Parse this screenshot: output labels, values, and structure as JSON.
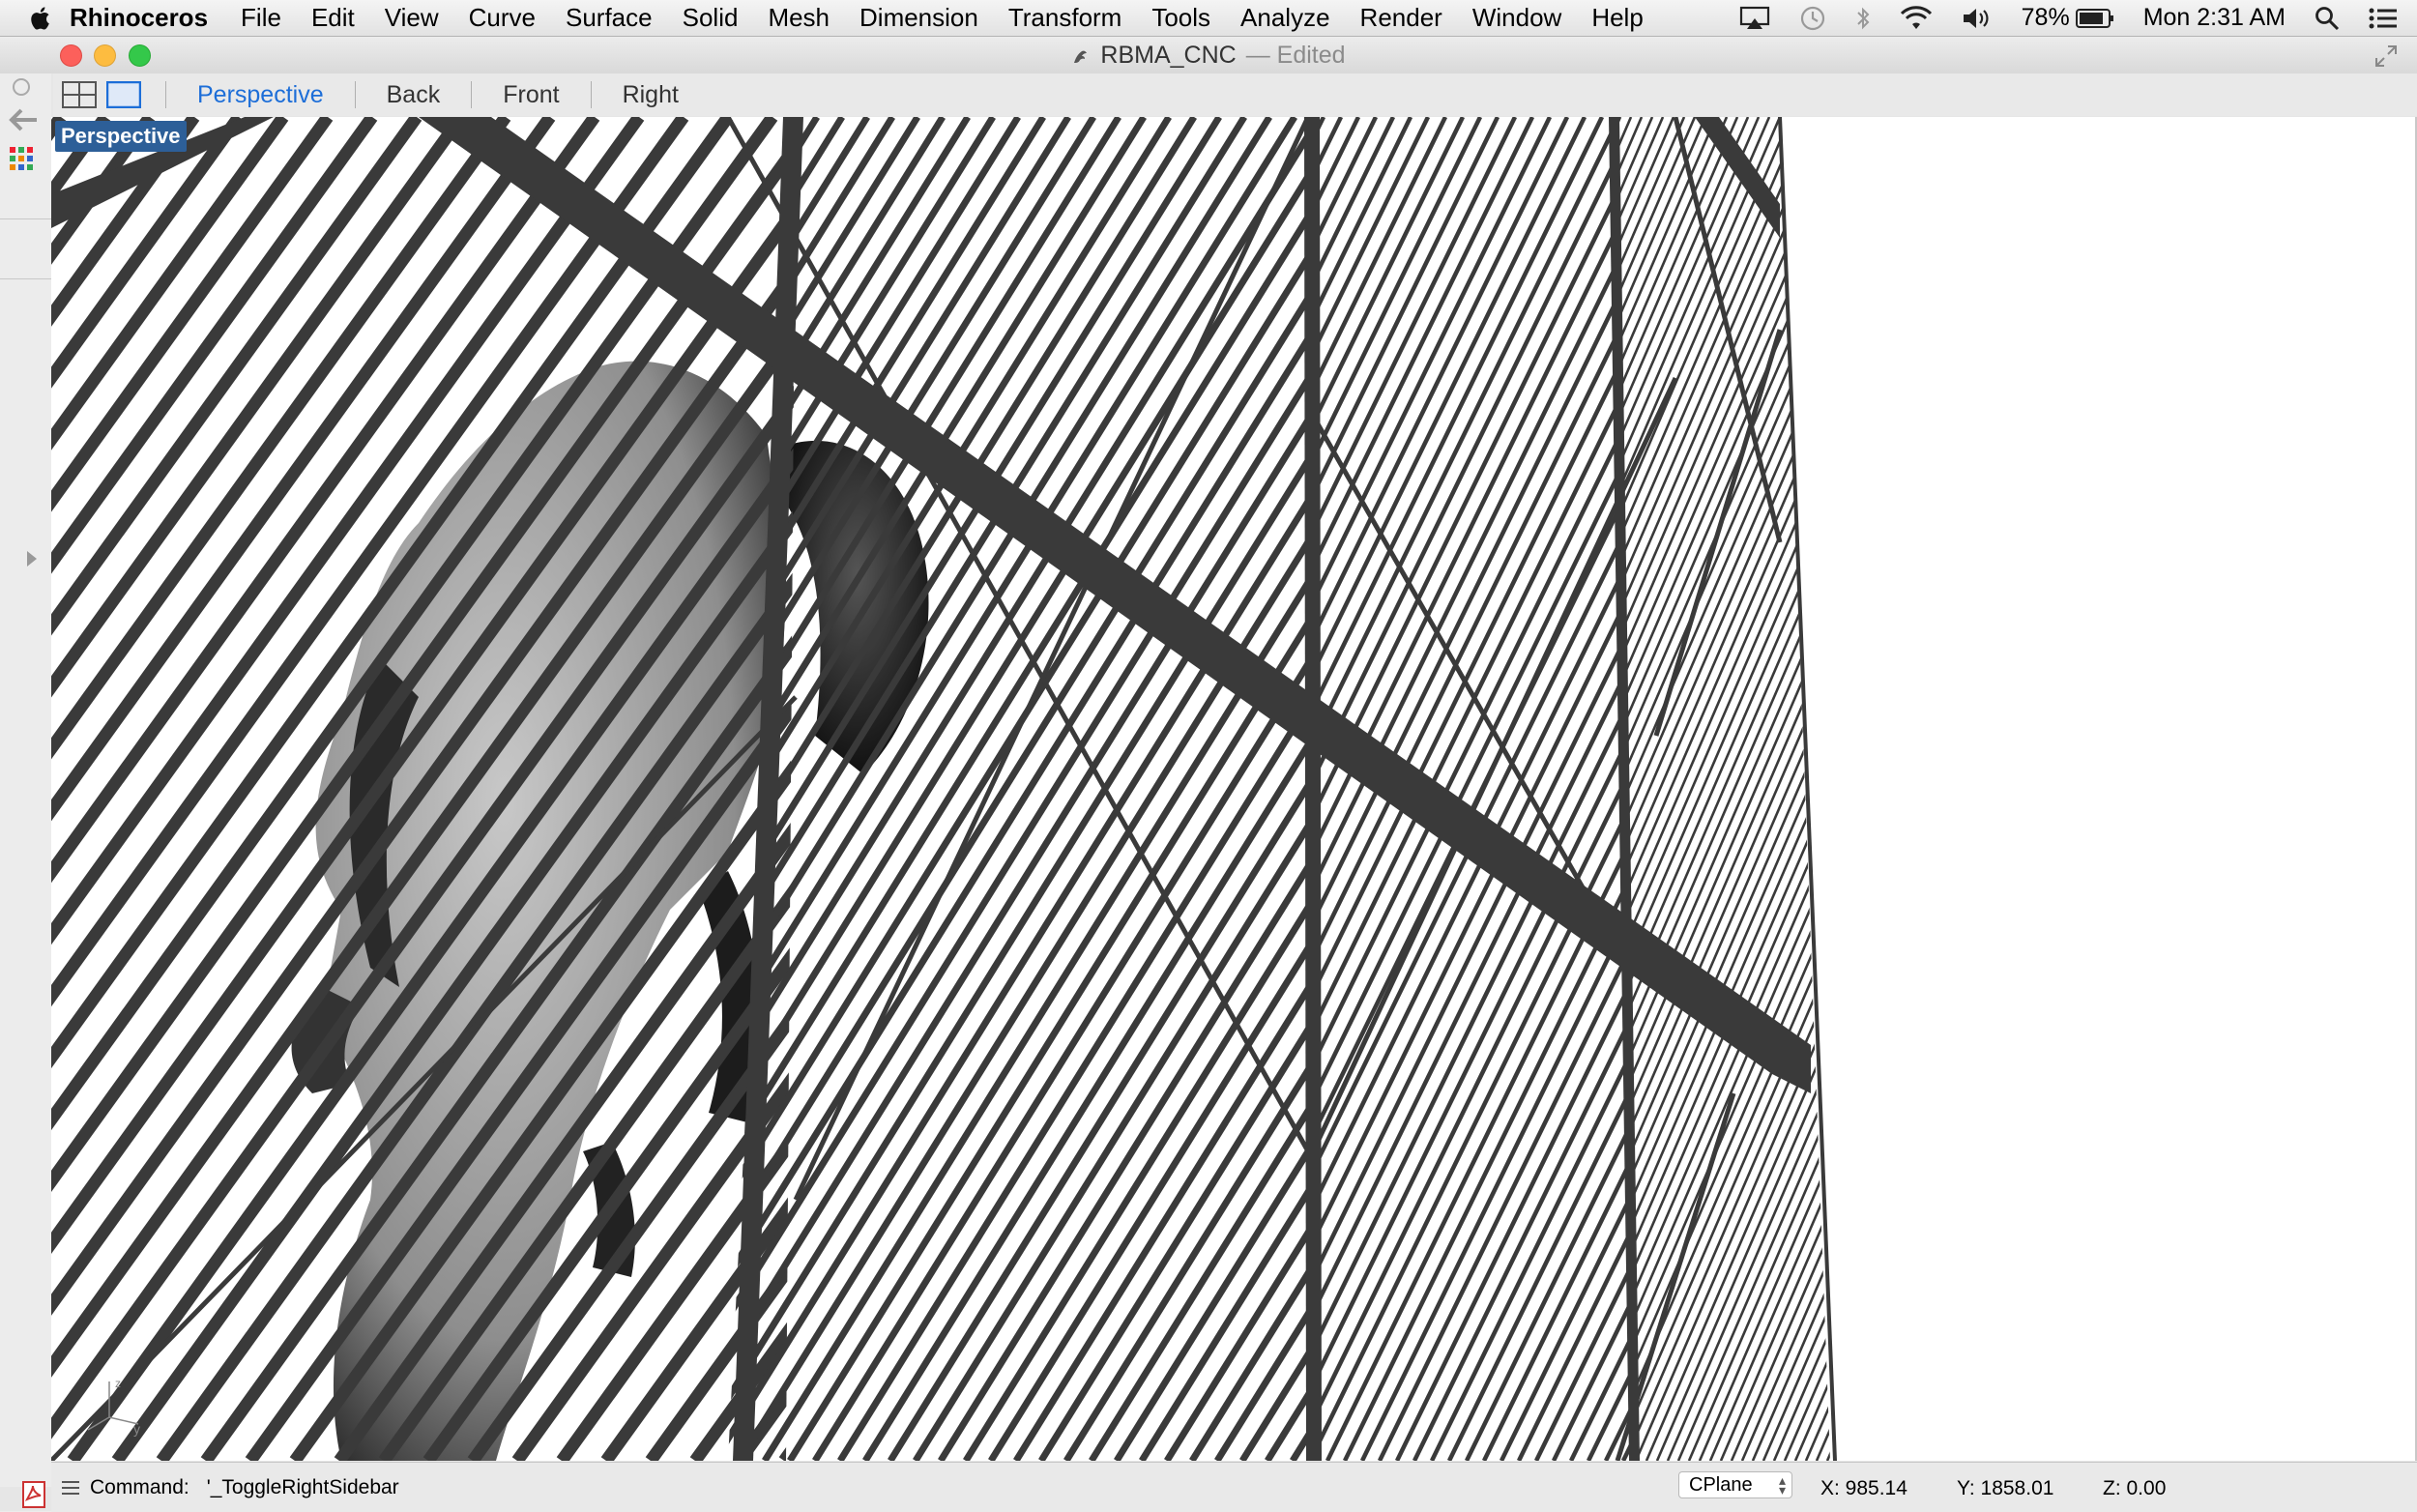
{
  "menubar": {
    "app_name": "Rhinoceros",
    "items": [
      "File",
      "Edit",
      "View",
      "Curve",
      "Surface",
      "Solid",
      "Mesh",
      "Dimension",
      "Transform",
      "Tools",
      "Analyze",
      "Render",
      "Window",
      "Help"
    ],
    "status": {
      "battery": "78%",
      "clock": "Mon 2:31 AM"
    },
    "icons": [
      "apple-icon",
      "airplay-icon",
      "time-machine-icon",
      "bluetooth-icon",
      "wifi-icon",
      "volume-icon",
      "battery-icon",
      "spotlight-icon",
      "notification-center-icon"
    ]
  },
  "window": {
    "title": "RBMA_CNC",
    "title_status": "— Edited"
  },
  "toolbar": {
    "tabs": [
      "Perspective",
      "Back",
      "Front",
      "Right"
    ],
    "active_tab": "Perspective"
  },
  "viewport": {
    "label": "Perspective",
    "colors": {
      "mullion": "#3a3a3a",
      "background": "#ffffff",
      "figure": "#9a9a9a"
    }
  },
  "statusbar": {
    "command_label": "Command:",
    "command_value": "'_ToggleRightSidebar",
    "cplane": "CPlane",
    "x": "X: 985.14",
    "y": "Y: 1858.01",
    "z": "Z: 0.00"
  },
  "colors": {
    "accent": "#1d6ed8",
    "label_bg": "#2d5f98"
  }
}
